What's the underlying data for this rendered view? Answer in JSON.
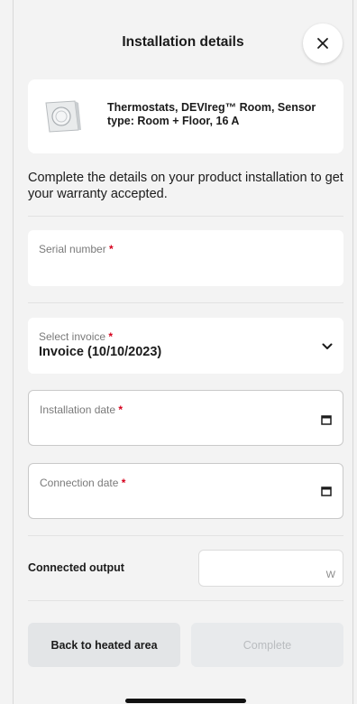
{
  "header": {
    "title": "Installation details",
    "close_icon": "close-icon"
  },
  "product": {
    "name": "Thermostats, DEVIreg™ Room, Sensor type: Room + Floor, 16 A",
    "thumbnail_icon": "thermostat-image"
  },
  "intro_text": "Complete the details on your product installation to get your warranty accepted.",
  "fields": {
    "serial_number": {
      "label": "Serial number",
      "required_mark": "*",
      "value": ""
    },
    "invoice": {
      "label": "Select invoice",
      "required_mark": "*",
      "value": "Invoice (10/10/2023)",
      "icon": "chevron-down-icon"
    },
    "installation_date": {
      "label": "Installation date",
      "required_mark": "*",
      "value": "",
      "icon": "calendar-icon"
    },
    "connection_date": {
      "label": "Connection date",
      "required_mark": "*",
      "value": "",
      "icon": "calendar-icon"
    }
  },
  "connected_output": {
    "label": "Connected output",
    "value": "",
    "unit": "W"
  },
  "buttons": {
    "back": "Back to heated area",
    "complete": "Complete"
  },
  "colors": {
    "background": "#f3f3f3",
    "required": "#d6001c",
    "disabled_text": "#b9bcbf"
  }
}
